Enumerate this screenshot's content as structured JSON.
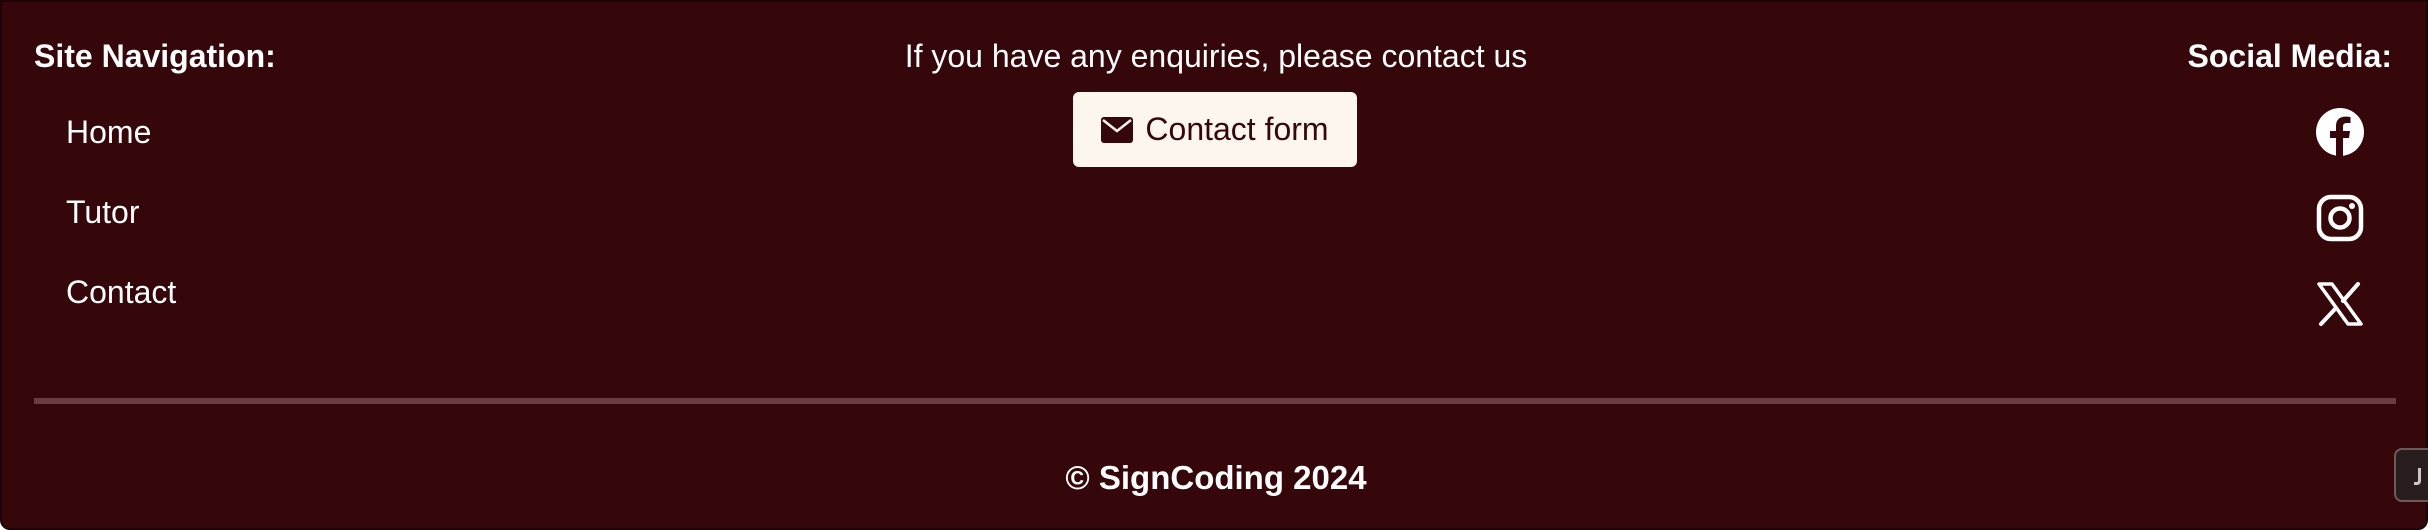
{
  "navigation": {
    "heading": "Site Navigation:",
    "items": [
      {
        "label": "Home"
      },
      {
        "label": "Tutor"
      },
      {
        "label": "Contact"
      }
    ]
  },
  "contact": {
    "text": "If you have any enquiries, please contact us",
    "button_label": "Contact form",
    "button_icon": "envelope-icon"
  },
  "social": {
    "heading": "Social Media:",
    "icons": [
      "facebook-icon",
      "instagram-icon",
      "x-twitter-icon"
    ]
  },
  "footer": {
    "copyright": "© SignCoding 2024"
  },
  "colors": {
    "background": "#35070a",
    "text": "#ffffff",
    "button_background": "#fdf6ec",
    "divider": "#6b3d3e"
  }
}
